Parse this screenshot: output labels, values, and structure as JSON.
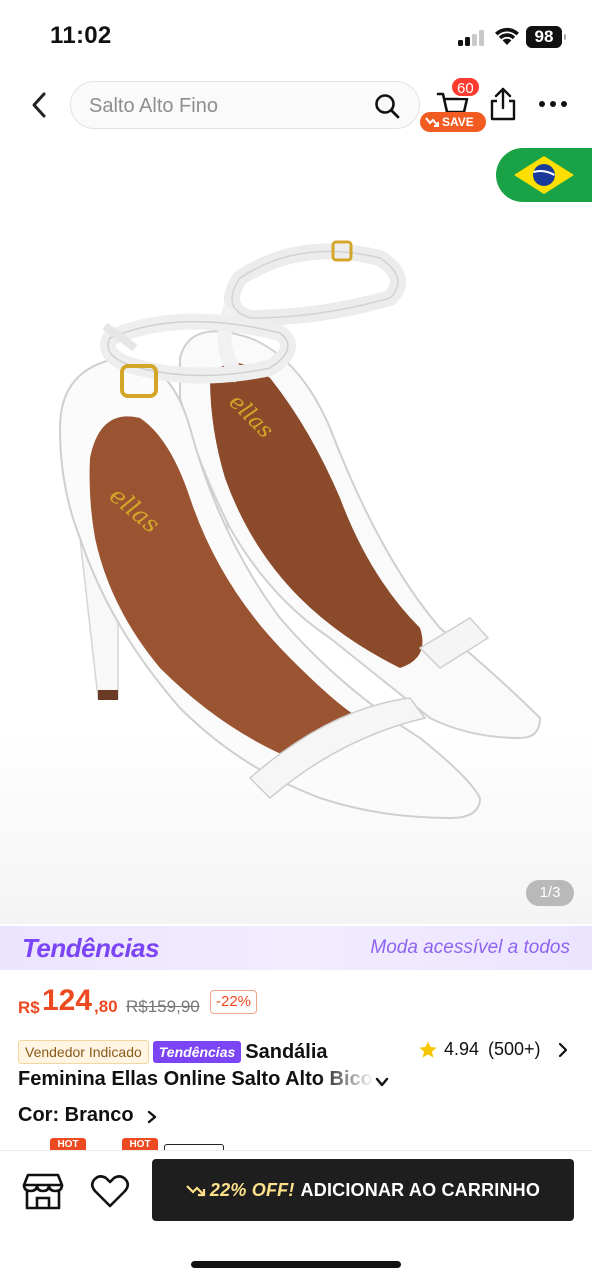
{
  "status_bar": {
    "time": "11:02",
    "battery": "98"
  },
  "header": {
    "search_placeholder": "Salto Alto Fino",
    "cart_count": "60",
    "save_label": "SAVE"
  },
  "product_image": {
    "page_indicator": "1/3",
    "shown_page": 1,
    "total_pages": 3
  },
  "trend_banner": {
    "logo": "Tendências",
    "tagline": "Moda acessível a todos"
  },
  "price": {
    "currency": "R$",
    "integer": "124",
    "decimal": ",80",
    "original": "R$159,90",
    "discount": "-22%"
  },
  "product": {
    "seller_tag": "Vendedor Indicado",
    "trend_tag": "Tendências",
    "title_line1": "Sandália",
    "title_line2": "Feminina Ellas Online Salto Alto Bico",
    "rating": "4.94",
    "rating_count": "(500+)",
    "color_label": "Cor: Branco"
  },
  "variants": {
    "hot_label": "HOT"
  },
  "bottom_bar": {
    "offer": "22% OFF!",
    "cta": "ADICIONAR AO CARRINHO"
  },
  "colors": {
    "accent_orange": "#ee4a22",
    "trend_purple": "#7b45f5",
    "cta_dark": "#1e1e1e"
  }
}
